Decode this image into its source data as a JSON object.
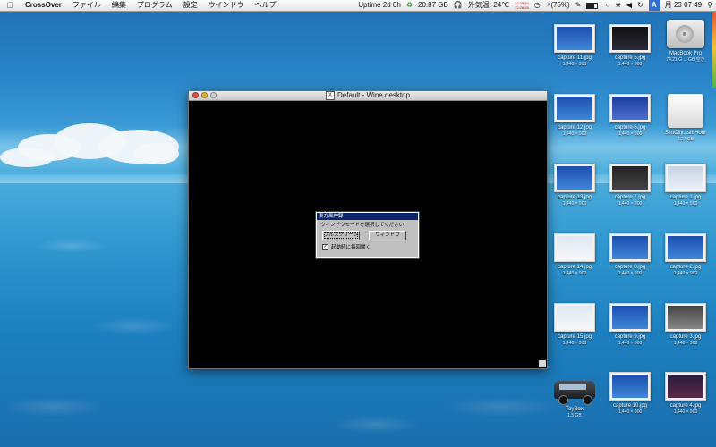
{
  "menubar": {
    "app_name": "CrossOver",
    "menus": [
      "ファイル",
      "編集",
      "プログラム",
      "設定",
      "ウインドウ",
      "ヘルプ"
    ],
    "status": {
      "uptime": "Uptime 2d 0h",
      "disk_free": "20.87 GB",
      "weather": "外気温: 24℃",
      "net_top": "12:28:20",
      "net_bottom": "12:28:26",
      "battery": "(75%)",
      "clock": "月 23 07 49",
      "spotlight": "A"
    }
  },
  "window": {
    "title": "Default - Wine desktop"
  },
  "dialog": {
    "title": "東方風神録",
    "message": "ウィンドウモードを選択してください",
    "fullscreen_button": "フルスクリーン",
    "window_button": "ウィンドウ",
    "checkbox_label": "起動時に毎回聞く",
    "checkbox_checked": true
  },
  "desktop_icons": [
    {
      "name": "capture 11.jpg",
      "size": "1,440 × 900"
    },
    {
      "name": "capture 5.jpg",
      "size": "1,440 × 900"
    },
    {
      "name": "MacBook Pro",
      "size": "74.21 G ... GB 空き"
    },
    {
      "name": "capture 12.jpg",
      "size": "1,440 × 900"
    },
    {
      "name": "capture 6.jpg",
      "size": "1,440 × 900"
    },
    {
      "name": "SimCity...sh Hour",
      "size": "1.27 GB"
    },
    {
      "name": "capture 13.jpg",
      "size": "1,440 × 900"
    },
    {
      "name": "capture 7.jpg",
      "size": "1,440 × 900"
    },
    {
      "name": "capture 1.jpg",
      "size": "1,440 × 900"
    },
    {
      "name": "capture 14.jpg",
      "size": "1,440 × 900"
    },
    {
      "name": "capture 8.jpg",
      "size": "1,440 × 900"
    },
    {
      "name": "capture 2.jpg",
      "size": "1,440 × 900"
    },
    {
      "name": "capture 15.jpg",
      "size": "1,440 × 900"
    },
    {
      "name": "capture 9.jpg",
      "size": "1,440 × 900"
    },
    {
      "name": "capture 3.jpg",
      "size": "1,440 × 900"
    },
    {
      "name": "ToyBox",
      "size": "1.5 GB"
    },
    {
      "name": "capture 10.jpg",
      "size": "1,440 × 900"
    },
    {
      "name": "capture 4.jpg",
      "size": "1,440 × 900"
    }
  ],
  "colors": {
    "dialog_title": "#0a246a",
    "wine_background": "#000000",
    "close": "#e2504b",
    "minimize": "#e3b231"
  }
}
